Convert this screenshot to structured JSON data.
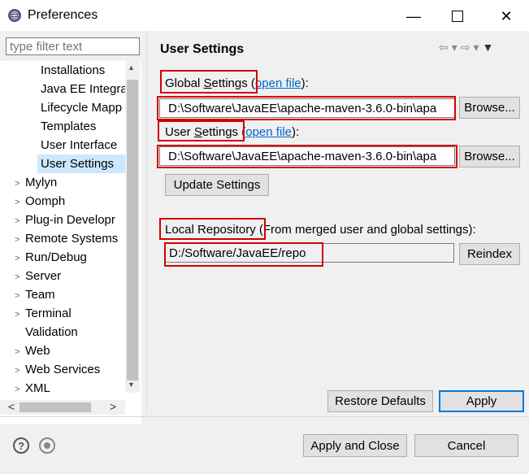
{
  "window": {
    "title": "Preferences",
    "minimize": "—",
    "close": "✕"
  },
  "filter": {
    "placeholder": "type filter text"
  },
  "tree": {
    "items": [
      {
        "label": "Installations"
      },
      {
        "label": "Java EE Integra"
      },
      {
        "label": "Lifecycle Mapp"
      },
      {
        "label": "Templates"
      },
      {
        "label": "User Interface"
      },
      {
        "label": "User Settings"
      },
      {
        "label": "Mylyn"
      },
      {
        "label": "Oomph"
      },
      {
        "label": "Plug-in Developr"
      },
      {
        "label": "Remote Systems"
      },
      {
        "label": "Run/Debug"
      },
      {
        "label": "Server"
      },
      {
        "label": "Team"
      },
      {
        "label": "Terminal"
      },
      {
        "label": "Validation"
      },
      {
        "label": "Web"
      },
      {
        "label": "Web Services"
      },
      {
        "label": "XML"
      }
    ]
  },
  "page": {
    "title": "User Settings",
    "global_settings": {
      "label_pre": "Global ",
      "label_u": "S",
      "label_post": "ettings",
      "paren_open": " (",
      "link": "open file",
      "paren_close": "):",
      "value": "D:\\Software\\JavaEE\\apache-maven-3.6.0-bin\\apa",
      "browse": "Browse..."
    },
    "user_settings": {
      "label_pre": "User ",
      "label_u": "S",
      "label_post": "ettings",
      "paren_open": " (",
      "link": "open file",
      "paren_close": "):",
      "value": "D:\\Software\\JavaEE\\apache-maven-3.6.0-bin\\apa",
      "browse": "Browse..."
    },
    "update_settings": "Update Settings",
    "local_repository": {
      "label": "Local Repository",
      "suffix": " (From merged user and global settings):",
      "value": "D:/Software/JavaEE/repo",
      "reindex": "Reindex"
    },
    "restore_defaults": "Restore Defaults",
    "apply": "Apply"
  },
  "footer": {
    "help": "?",
    "apply_close": "Apply and Close",
    "cancel": "Cancel"
  }
}
